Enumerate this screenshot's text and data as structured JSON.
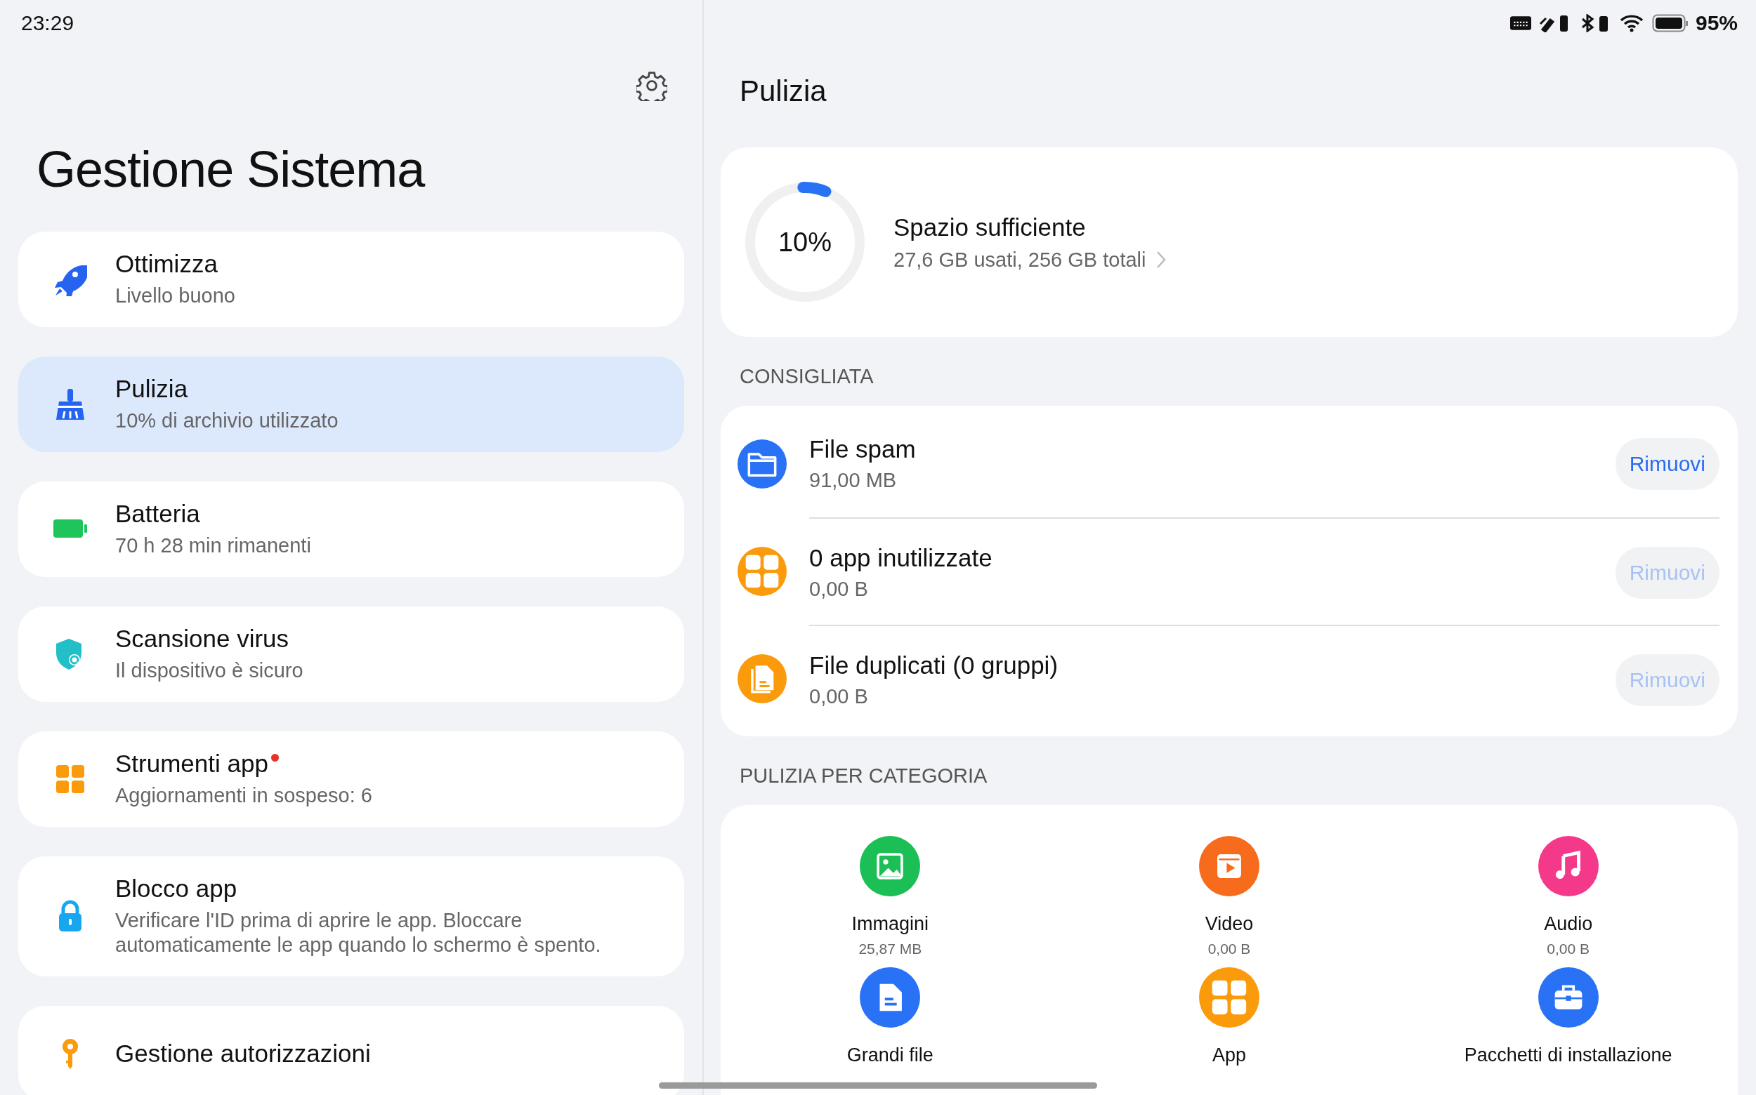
{
  "status_bar": {
    "time": "23:29",
    "battery": "95%"
  },
  "sidebar": {
    "title": "Gestione Sistema",
    "items": [
      {
        "kind": "rocket",
        "title": "Ottimizza",
        "subtitle": "Livello buono",
        "selected": false,
        "badge": false
      },
      {
        "kind": "broom",
        "title": "Pulizia",
        "subtitle": "10% di archivio utilizzato",
        "selected": true,
        "badge": false
      },
      {
        "kind": "battery",
        "title": "Batteria",
        "subtitle": "70 h 28 min rimanenti",
        "selected": false,
        "badge": false
      },
      {
        "kind": "shield",
        "title": "Scansione virus",
        "subtitle": "Il dispositivo è sicuro",
        "selected": false,
        "badge": false
      },
      {
        "kind": "grid",
        "title": "Strumenti app",
        "subtitle": "Aggiornamenti in sospeso: 6",
        "selected": false,
        "badge": true
      },
      {
        "kind": "lock",
        "title": "Blocco app",
        "subtitle": "Verificare l'ID prima di aprire le app. Bloccare automaticamente le app quando lo schermo è spento.",
        "selected": false,
        "badge": false
      },
      {
        "kind": "key",
        "title": "Gestione autorizzazioni",
        "selected": false,
        "badge": false
      }
    ]
  },
  "page": {
    "title": "Pulizia",
    "storage": {
      "percent": "10%",
      "level": 0.1,
      "title": "Spazio sufficiente",
      "detail": "27,6 GB usati, 256 GB totali"
    },
    "recommended": {
      "heading": "CONSIGLIATA",
      "rows": [
        {
          "kind": "folder",
          "title": "File spam",
          "size": "91,00 MB",
          "button": "Rimuovi",
          "disabled": false
        },
        {
          "kind": "grid",
          "title": "0 app inutilizzate",
          "size": "0,00 B",
          "button": "Rimuovi",
          "disabled": true
        },
        {
          "kind": "files",
          "title": "File duplicati (0 gruppi)",
          "size": "0,00 B",
          "button": "Rimuovi",
          "disabled": true
        }
      ]
    },
    "categories": {
      "heading": "PULIZIA PER CATEGORIA",
      "items": [
        {
          "kind": "image",
          "label": "Immagini",
          "size": "25,87 MB",
          "color": "#1bbf55"
        },
        {
          "kind": "video",
          "label": "Video",
          "size": "0,00 B",
          "color": "#f76b1c"
        },
        {
          "kind": "music",
          "label": "Audio",
          "size": "0,00 B",
          "color": "#f5398a"
        },
        {
          "kind": "doc",
          "label": "Grandi file",
          "color": "#2a72f5"
        },
        {
          "kind": "grid",
          "label": "App",
          "color": "#fb9a0a"
        },
        {
          "kind": "case",
          "label": "Pacchetti di installazione",
          "color": "#2a72f5"
        }
      ]
    }
  }
}
